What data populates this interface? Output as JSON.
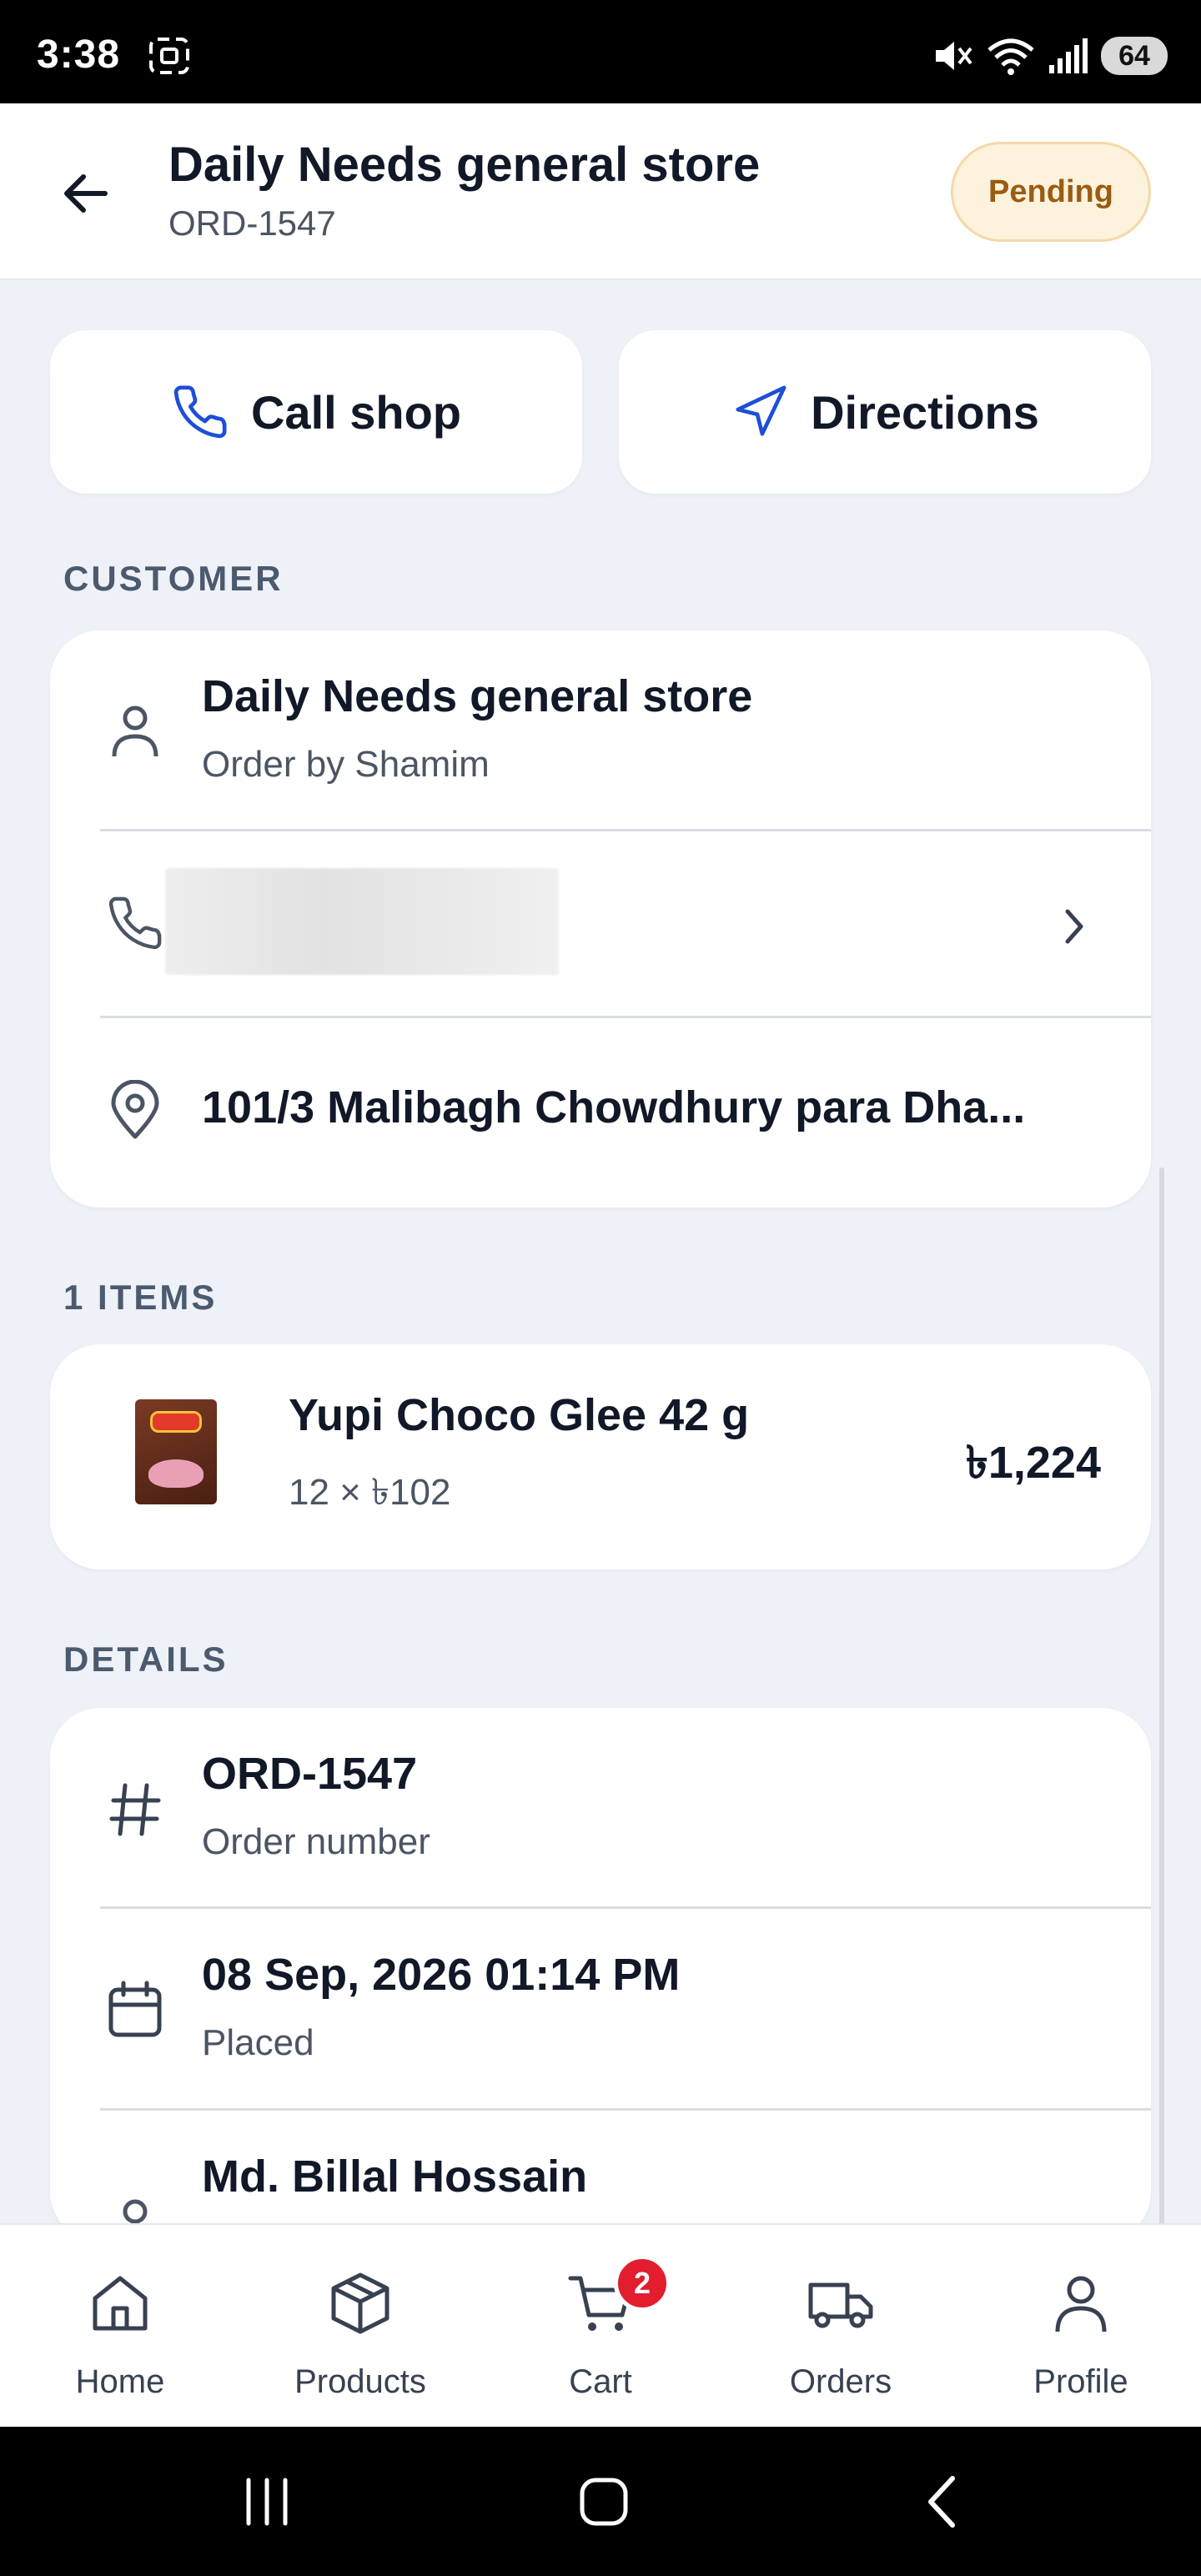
{
  "status_bar": {
    "time": "3:38",
    "battery": "64",
    "icons": [
      "screenshot-icon",
      "mute-icon",
      "wifi-icon",
      "signal-icon"
    ]
  },
  "header": {
    "title": "Daily Needs general store",
    "order_id": "ORD-1547",
    "status": "Pending"
  },
  "actions": {
    "call_label": "Call shop",
    "directions_label": "Directions"
  },
  "customer": {
    "section_label": "CUSTOMER",
    "shop_name": "Daily Needs general store",
    "ordered_by": "Order by Shamim",
    "address": "101/3 Malibagh Chowdhury para Dha..."
  },
  "items": {
    "section_label": "1 ITEMS",
    "list": [
      {
        "name": "Yupi Choco Glee 42 g",
        "qty_price": "12 × ৳102",
        "total": "৳1,224"
      }
    ]
  },
  "details": {
    "section_label": "DETAILS",
    "order_number": "ORD-1547",
    "order_number_label": "Order number",
    "placed_at": "08 Sep, 2026 01:14 PM",
    "placed_label": "Placed",
    "assignee": "Md. Billal Hossain"
  },
  "bottom_nav": {
    "home": "Home",
    "products": "Products",
    "cart": "Cart",
    "cart_badge": "2",
    "orders": "Orders",
    "profile": "Profile"
  },
  "colors": {
    "accent": "#1d4ed8",
    "pending_bg": "#fdf3dc",
    "pending_text": "#9a5b13",
    "badge": "#e11d2e",
    "page_bg": "#eef1f7"
  }
}
